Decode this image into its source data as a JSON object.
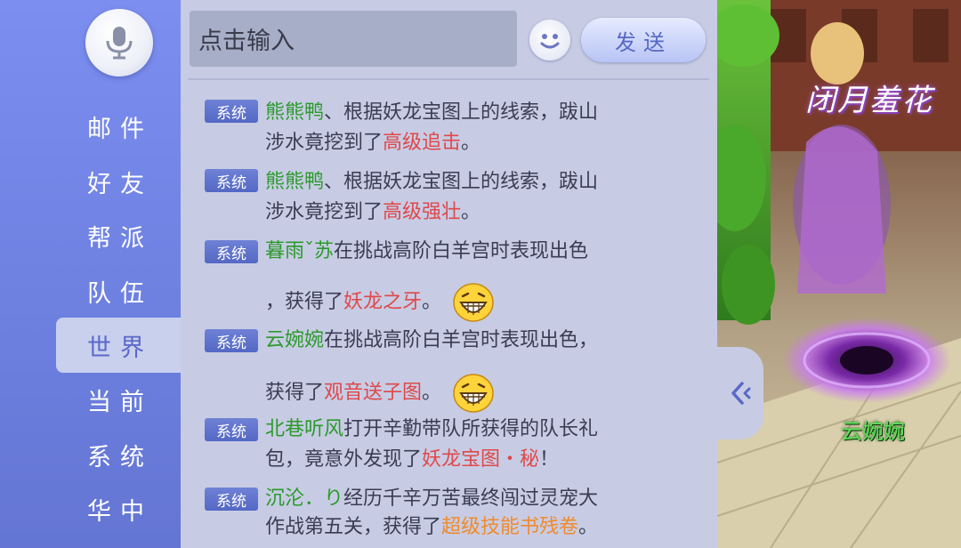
{
  "sidebar": {
    "mic_icon": "microphone-icon",
    "items": [
      {
        "label": "邮件",
        "active": false
      },
      {
        "label": "好友",
        "active": false
      },
      {
        "label": "帮派",
        "active": false
      },
      {
        "label": "队伍",
        "active": false
      },
      {
        "label": "世界",
        "active": true
      },
      {
        "label": "当前",
        "active": false
      },
      {
        "label": "系统",
        "active": false
      },
      {
        "label": "华中",
        "active": false
      }
    ]
  },
  "input": {
    "placeholder": "点击输入"
  },
  "emoji_icon": "smiley-face-icon",
  "send_label": "发送",
  "collapse_icon": "double-chevron-left-icon",
  "messages": [
    {
      "tag": "系统",
      "name": "熊熊鸭",
      "line1_rest": "、根据妖龙宝图上的线索，跋山",
      "line2_pre": "涉水竟挖到了",
      "item": "高级追击",
      "line2_post": "。"
    },
    {
      "tag": "系统",
      "name": "熊熊鸭",
      "line1_rest": "、根据妖龙宝图上的线索，跋山",
      "line2_pre": "涉水竟挖到了",
      "item": "高级强壮",
      "line2_post": "。"
    },
    {
      "tag": "系统",
      "name": "暮雨ˇ苏",
      "line1_rest": "在挑战高阶白羊宫时表现出色",
      "line2_pre": "，获得了",
      "item": "妖龙之牙",
      "line2_post": "。"
    },
    {
      "tag": "系统",
      "name": "云婉婉",
      "line1_rest": "在挑战高阶白羊宫时表现出色，",
      "line2_pre": "获得了",
      "item": "观音送子图",
      "line2_post": "。"
    },
    {
      "tag": "系统",
      "name": "北巷听风",
      "line1_rest": "打开辛勤带队所获得的队长礼",
      "line2_pre": "包，竟意外发现了",
      "item": "妖龙宝图・秘",
      "line2_post": "！"
    },
    {
      "tag": "系统",
      "name": "沉沦．り",
      "line1_rest": "经历千辛万苦最终闯过灵宠大",
      "line2_pre": "作战第五关，获得了",
      "item": "超级技能书残卷",
      "line2_post": "。"
    }
  ],
  "scene": {
    "banner_text": "闭月羞花",
    "character_name": "云婉婉"
  },
  "colors": {
    "player_name": "#2b9a2a",
    "item_red": "#e0484a",
    "item_orange": "#f08a2c",
    "system_tag": "#5a6cc8"
  }
}
